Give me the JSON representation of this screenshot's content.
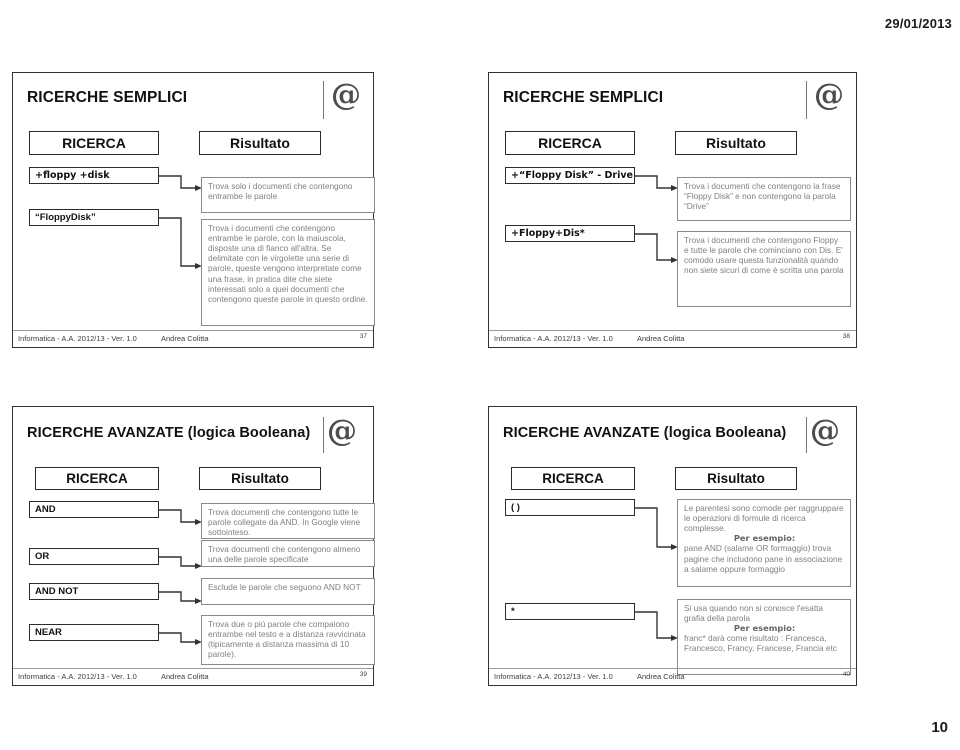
{
  "document": {
    "date": "29/01/2013",
    "page_number": "10"
  },
  "footer_common": {
    "course": "Informatica - A.A. 2012/13 - Ver. 1.0",
    "author": "Andrea Colitta"
  },
  "logo": {
    "glyph": "@"
  },
  "slides": [
    {
      "title": "RICERCHE SEMPLICI",
      "headers": {
        "query": "RICERCA",
        "result": "Risultato"
      },
      "page": "37",
      "rows": [
        {
          "query": "+floppy +disk",
          "result": "Trova solo i documenti che contengono entrambe le parole"
        },
        {
          "query": "“FloppyDisk”",
          "result": "Trova i documenti che contengono entrambe le parole, con la maiuscola, disposte una di fianco all'altra. Se delimitate con le virgolette una serie di parole, queste vengono interpretate come una frase, in pratica dite che siete interessati solo a quei documenti che contengono queste parole in questo ordine."
        }
      ]
    },
    {
      "title": "RICERCHE SEMPLICI",
      "headers": {
        "query": "RICERCA",
        "result": "Risultato"
      },
      "page": "38",
      "rows": [
        {
          "query": "+“Floppy Disk” - Drive",
          "result": "Trova i documenti che contengono la frase “Floppy Disk” e non contengono la parola “Drive”"
        },
        {
          "query": "+Floppy+Dis*",
          "result": "Trova i documenti che contengono Floppy e tutte le parole che cominciano con Dis. E' comodo usare questa funzionalità quando non siete sicuri di come è scritta una parola"
        }
      ]
    },
    {
      "title": "RICERCHE AVANZATE (logica Booleana)",
      "headers": {
        "query": "RICERCA",
        "result": "Risultato"
      },
      "page": "39",
      "rows": [
        {
          "query": "AND",
          "result": "Trova documenti che contengono tutte le parole collegate da AND. In Google viene sottointeso."
        },
        {
          "query": "OR",
          "result": "Trova documenti che contengono almeno una delle parole specificate"
        },
        {
          "query": "AND NOT",
          "result": "Esclude le parole che seguono AND NOT"
        },
        {
          "query": "NEAR",
          "result": "Trova due o piú parole che compaiono entrambe nel testo e a distanza ravvicinata (tipicamente a distanza massima di 10 parole)."
        }
      ]
    },
    {
      "title": "RICERCHE AVANZATE (logica Booleana)",
      "headers": {
        "query": "RICERCA",
        "result": "Risultato"
      },
      "page": "40",
      "rows": [
        {
          "query": "( )",
          "result_pre": "Le parentesi sono comode per raggruppare le operazioni di formule di ricerca complesse.",
          "result_example_label": "Per esempio:",
          "result_post": "pane AND (salame OR formaggio) trova pagine che includono pane in associazione a salame oppure formaggio"
        },
        {
          "query": "*",
          "result_pre": "Si usa quando non si conosce l'esatta grafia della parola",
          "result_example_label": "Per esempio:",
          "result_post": "franc* darà come risultato : Francesca, Francesco, Francy, Francese, Francia etc"
        }
      ]
    }
  ]
}
